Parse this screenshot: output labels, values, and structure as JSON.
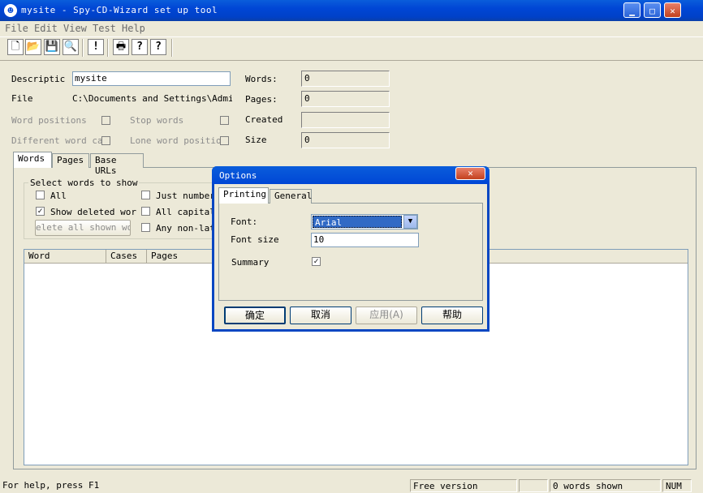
{
  "window": {
    "title": "mysite - Spy-CD-Wizard set up tool"
  },
  "menu": [
    "File",
    "Edit",
    "View",
    "Test",
    "Help"
  ],
  "toolbar": {
    "icons": [
      "new-icon",
      "open-icon",
      "save-icon",
      "search-icon",
      "exclamation-icon",
      "print-icon",
      "help-icon",
      "context-help-icon"
    ],
    "glyphs": [
      "🗋",
      "📂",
      "💾",
      "🔍",
      "!",
      "🖶",
      "?",
      "?"
    ]
  },
  "form": {
    "description_label": "Descriptic",
    "description_value": "mysite",
    "file_label": "File",
    "file_value": "C:\\Documents and Settings\\Adminis",
    "word_positions": "Word positions",
    "stop_words": "Stop words",
    "different_word_case": "Different word cas",
    "lone_word_positions": "Lone word positions",
    "words_label": "Words:",
    "words_value": "0",
    "pages_label": "Pages:",
    "pages_value": "0",
    "created_label": "Created",
    "created_value": "",
    "size_label": "Size",
    "size_value": "0"
  },
  "tabs": [
    "Words",
    "Pages",
    "Base URLs"
  ],
  "words_tab": {
    "group_title": "Select words to show",
    "all": "All",
    "show_deleted": "Show deleted words",
    "delete_btn": "elete all shown wor",
    "just_numbers": "Just numbers",
    "all_capitals": "All capitals",
    "any_non_latin": "Any non-lati",
    "columns": [
      "Word",
      "Cases",
      "Pages"
    ]
  },
  "dialog": {
    "title": "Options",
    "tabs": [
      "Printing",
      "General"
    ],
    "font_label": "Font:",
    "font_value": "Arial",
    "font_size_label": "Font size",
    "font_size_value": "10",
    "summary_label": "Summary",
    "summary_checked": "✓",
    "ok": "确定",
    "cancel": "取消",
    "apply": "应用(A)",
    "help": "帮助"
  },
  "status": {
    "help": "For help, press F1",
    "version": "Free version",
    "words_shown": "0 words shown",
    "num": "NUM"
  },
  "colors": {
    "titlebar": "#0046d5",
    "face": "#ece9d8",
    "selection": "#316ac5"
  }
}
